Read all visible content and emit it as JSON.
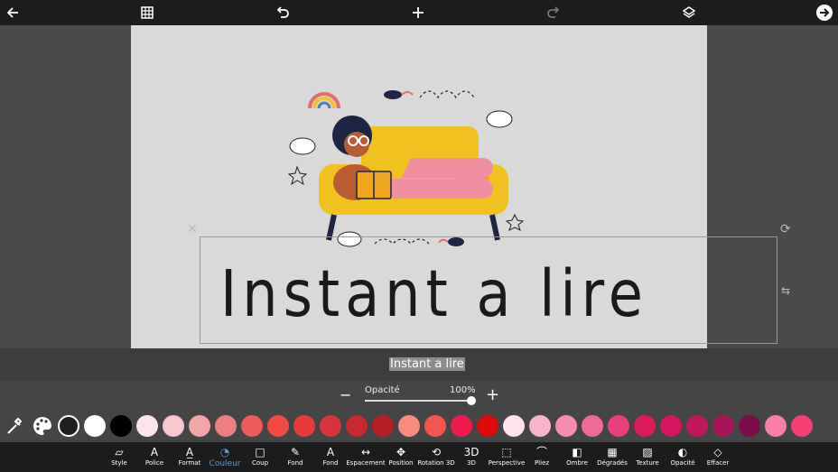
{
  "topbar": {
    "icons": [
      "back-arrow-icon",
      "grid-icon",
      "undo-icon",
      "add-icon",
      "redo-icon",
      "layers-icon",
      "next-arrow-icon"
    ]
  },
  "canvas": {
    "title_text": "Instant a lire"
  },
  "text_field": {
    "value": "Instant a lire"
  },
  "opacity": {
    "label": "Opacité",
    "value": "100%",
    "level": 1.0,
    "minus": "−",
    "plus": "+"
  },
  "colors": {
    "swatches": [
      "#1f1f1f",
      "#ffffff",
      "#000000",
      "#fde3ea",
      "#fbc7cf",
      "#f4a5a9",
      "#ed7f80",
      "#ec5a5a",
      "#f04a43",
      "#e83a3a",
      "#d8323a",
      "#c9282d",
      "#b81e24",
      "#fa8a7c",
      "#f4554f",
      "#f0194b",
      "#e00a0a",
      "#fde3ea",
      "#f6b5cb",
      "#f38db0",
      "#ee6a98",
      "#ea3f7d",
      "#e0185c",
      "#d4155f",
      "#c2165c",
      "#a8145a",
      "#7a0d4a",
      "#f77faa",
      "#f43f74"
    ]
  },
  "tools": [
    {
      "label": "Style",
      "icon": "style-icon"
    },
    {
      "label": "Police",
      "icon": "font-icon"
    },
    {
      "label": "Format",
      "icon": "format-icon"
    },
    {
      "label": "Couleur",
      "icon": "palette-icon"
    },
    {
      "label": "Coup",
      "icon": "stroke-icon"
    },
    {
      "label": "Fond",
      "icon": "brush-icon"
    },
    {
      "label": "Fond",
      "icon": "background-letter-icon"
    },
    {
      "label": "Espacement",
      "icon": "spacing-icon"
    },
    {
      "label": "Position",
      "icon": "move-icon"
    },
    {
      "label": "Rotation 3D",
      "icon": "rotation-3d-icon"
    },
    {
      "label": "3D",
      "icon": "3d-icon"
    },
    {
      "label": "Perspective",
      "icon": "perspective-icon"
    },
    {
      "label": "Pliez",
      "icon": "curve-icon"
    },
    {
      "label": "Ombre",
      "icon": "shadow-icon"
    },
    {
      "label": "Dégradés",
      "icon": "gradient-icon"
    },
    {
      "label": "Texture",
      "icon": "texture-icon"
    },
    {
      "label": "Opacité",
      "icon": "opacity-icon"
    },
    {
      "label": "Effacer",
      "icon": "eraser-icon"
    }
  ]
}
